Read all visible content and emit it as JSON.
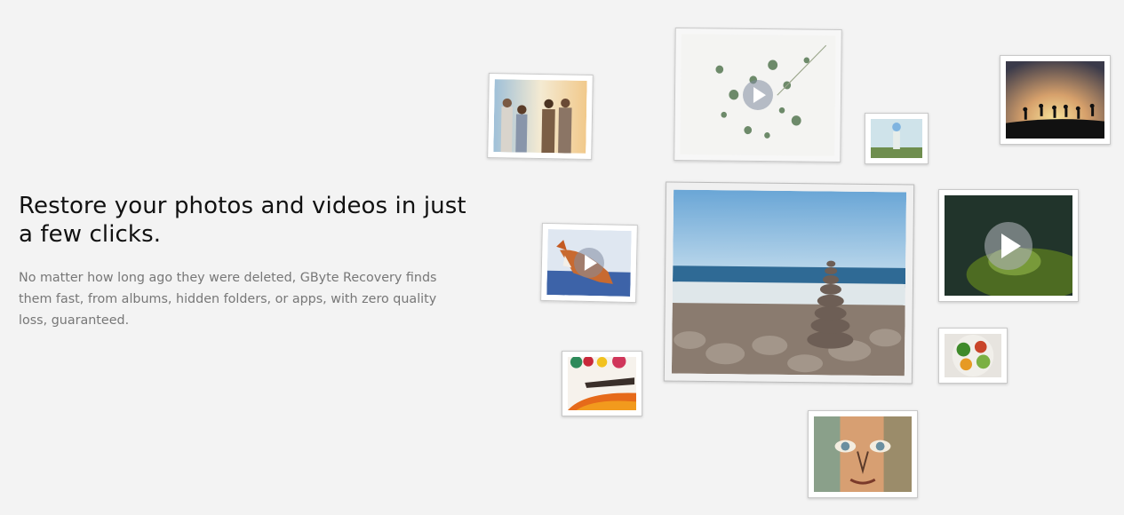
{
  "hero": {
    "title": "Restore your photos and videos in just a few clicks.",
    "description": "No matter how long ago they were deleted, GByte Recovery finds them fast, from albums, hidden folders, or apps, with zero quality loss, guaranteed."
  },
  "gallery": {
    "photos": [
      {
        "id": "friends",
        "kind": "photo"
      },
      {
        "id": "plants",
        "kind": "video"
      },
      {
        "id": "statue",
        "kind": "photo"
      },
      {
        "id": "sunset",
        "kind": "photo"
      },
      {
        "id": "fox",
        "kind": "video"
      },
      {
        "id": "beach",
        "kind": "photo"
      },
      {
        "id": "moss",
        "kind": "video"
      },
      {
        "id": "paint",
        "kind": "photo"
      },
      {
        "id": "salad",
        "kind": "photo"
      },
      {
        "id": "face",
        "kind": "photo"
      }
    ],
    "icons": {
      "play": "play-icon"
    }
  }
}
